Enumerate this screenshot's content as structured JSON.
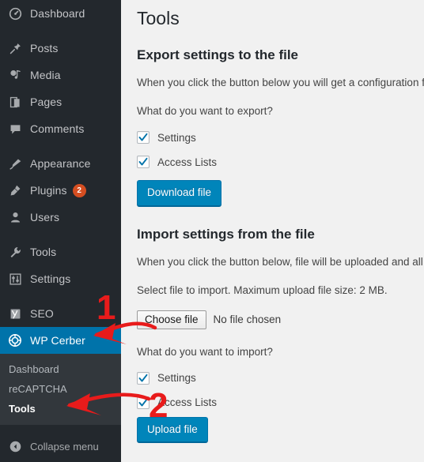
{
  "sidebar": {
    "items": [
      {
        "label": "Dashboard",
        "icon": "dashboard-icon",
        "badge": null
      },
      {
        "label": "Posts",
        "icon": "pin-icon",
        "badge": null
      },
      {
        "label": "Media",
        "icon": "media-icon",
        "badge": null
      },
      {
        "label": "Pages",
        "icon": "pages-icon",
        "badge": null
      },
      {
        "label": "Comments",
        "icon": "comment-icon",
        "badge": null
      },
      {
        "label": "Appearance",
        "icon": "brush-icon",
        "badge": null
      },
      {
        "label": "Plugins",
        "icon": "plug-icon",
        "badge": "2"
      },
      {
        "label": "Users",
        "icon": "user-icon",
        "badge": null
      },
      {
        "label": "Tools",
        "icon": "wrench-icon",
        "badge": null
      },
      {
        "label": "Settings",
        "icon": "sliders-icon",
        "badge": null
      },
      {
        "label": "SEO",
        "icon": "yoast-seo-icon",
        "badge": null
      },
      {
        "label": "WP Cerber",
        "icon": "cerber-target-icon",
        "badge": null
      }
    ],
    "submenu": [
      {
        "label": "Dashboard",
        "current": false
      },
      {
        "label": "reCAPTCHA",
        "current": false
      },
      {
        "label": "Tools",
        "current": true
      }
    ],
    "collapse": {
      "label": "Collapse menu",
      "icon": "chevron-left-circle-icon"
    },
    "colors": {
      "background": "#23282d",
      "submenu_background": "#32373c",
      "active_background": "#0073aa",
      "badge": "#d54e21"
    }
  },
  "main": {
    "page_title": "Tools",
    "export": {
      "heading": "Export settings to the file",
      "description": "When you click the button below you will get a configuration fi",
      "question": "What do you want to export?",
      "checkboxes": [
        {
          "label": "Settings",
          "checked": true
        },
        {
          "label": "Access Lists",
          "checked": true
        }
      ],
      "button": "Download file"
    },
    "import": {
      "heading": "Import settings from the file",
      "description": "When you click the button below, file will be uploaded and all e",
      "select_note": "Select file to import. Maximum upload file size: 2 MB.",
      "choose_button": "Choose file",
      "file_status": "No file chosen",
      "question": "What do you want to import?",
      "checkboxes": [
        {
          "label": "Settings",
          "checked": true
        },
        {
          "label": "Access Lists",
          "checked": true
        }
      ],
      "button": "Upload file"
    },
    "colors": {
      "button": "#0085ba",
      "background": "#f1f1f1",
      "checkmark": "#0073aa"
    }
  },
  "annotations": {
    "color": "#e81b1b",
    "markers": [
      {
        "number": "1",
        "points_at": "WP Cerber"
      },
      {
        "number": "2",
        "points_at": "Tools"
      }
    ]
  }
}
